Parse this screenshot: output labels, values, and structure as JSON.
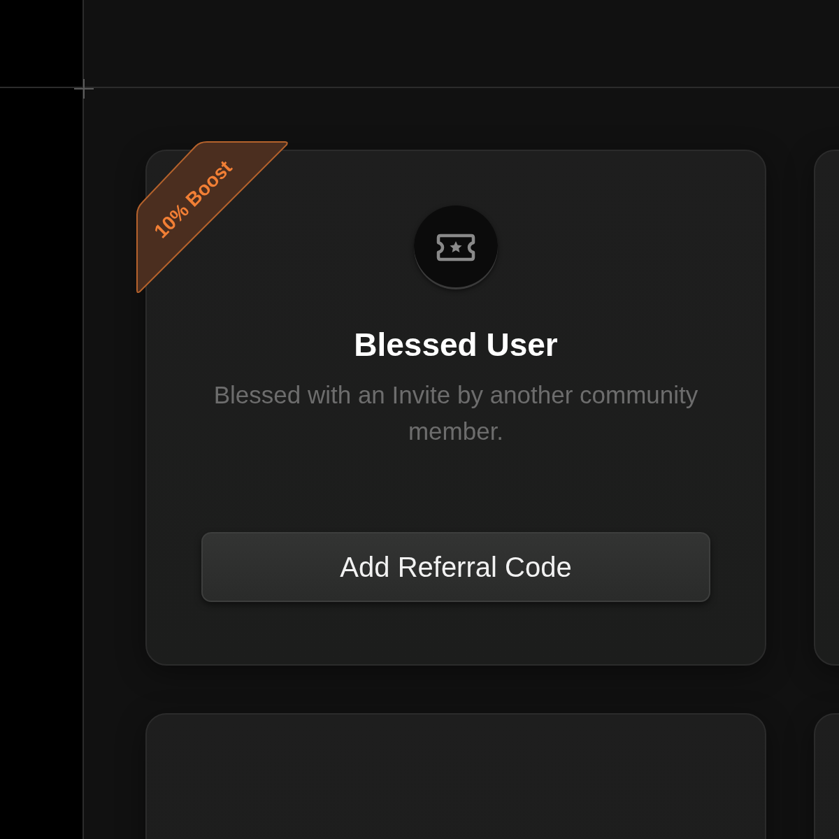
{
  "cards": [
    {
      "kind": "full",
      "badge": "10% Boost",
      "title": "Blessed User",
      "description": "Blessed with an Invite by another community member.",
      "button": "Add Referral Code"
    },
    {
      "kind": "blank"
    },
    {
      "kind": "blank"
    },
    {
      "kind": "blank"
    }
  ]
}
